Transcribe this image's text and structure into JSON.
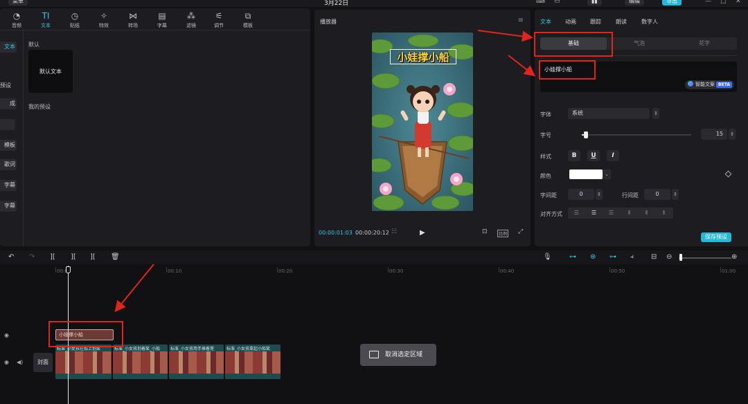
{
  "top_bar": {
    "menu_label": "菜单",
    "title": "3月22日",
    "share_label": "编辑",
    "export_label": "导出"
  },
  "toolbar": [
    {
      "label": "音频",
      "icon": "audio-icon"
    },
    {
      "label": "文本",
      "icon": "text-icon"
    },
    {
      "label": "贴纸",
      "icon": "sticker-icon"
    },
    {
      "label": "特效",
      "icon": "effects-icon"
    },
    {
      "label": "转场",
      "icon": "transition-icon"
    },
    {
      "label": "字幕",
      "icon": "caption-icon"
    },
    {
      "label": "滤镜",
      "icon": "filter-icon"
    },
    {
      "label": "调节",
      "icon": "adjust-icon"
    },
    {
      "label": "模板",
      "icon": "template-icon"
    }
  ],
  "sidebar": {
    "items": [
      "文本",
      "预设",
      "成",
      "",
      "模板",
      "歌词",
      "字幕",
      "字幕"
    ]
  },
  "library": {
    "default_section": "默认",
    "default_card": "默认文本",
    "my_presets": "我的预设"
  },
  "player": {
    "title": "播放器",
    "current_time": "00:00:01:03",
    "total_time": "00:00:20:12",
    "video_title": "小娃撑小船",
    "ratio_label": "比例"
  },
  "inspector": {
    "tabs": [
      "文本",
      "动画",
      "跟踪",
      "朗读",
      "数字人"
    ],
    "sub_tabs": [
      "基础",
      "气泡",
      "花字"
    ],
    "text_value": "小娃撑小船",
    "smart_label": "智能文案",
    "beta_label": "BETA",
    "font_label": "字体",
    "font_value": "系统",
    "size_label": "字号",
    "size_value": "15",
    "size_fraction": 0.04,
    "style_label": "样式",
    "style_buttons": [
      "B",
      "U",
      "I"
    ],
    "color_label": "颜色",
    "color_value": "#ffffff",
    "letter_spacing_label": "字间距",
    "letter_spacing_value": "0",
    "line_spacing_label": "行间距",
    "line_spacing_value": "0",
    "align_label": "对齐方式",
    "save_label": "保存预设"
  },
  "timeline": {
    "ticks": [
      "00:00",
      "00:10",
      "00:20",
      "00:30",
      "00:40",
      "00:50",
      "01:00"
    ],
    "text_clip": "小娃撑小船",
    "cover_label": "封面",
    "video_clips": [
      "标准_小女孩在船上划桨",
      "标准_小女孩划着桨_小船",
      "标准_小女孩用手捧着莲",
      "标准_小女孩拿起小船桨"
    ],
    "toast": "取消选定区域"
  },
  "colors": {
    "accent": "#2ec9e6",
    "annotation": "#e0251b",
    "save": "#22b8d6"
  }
}
